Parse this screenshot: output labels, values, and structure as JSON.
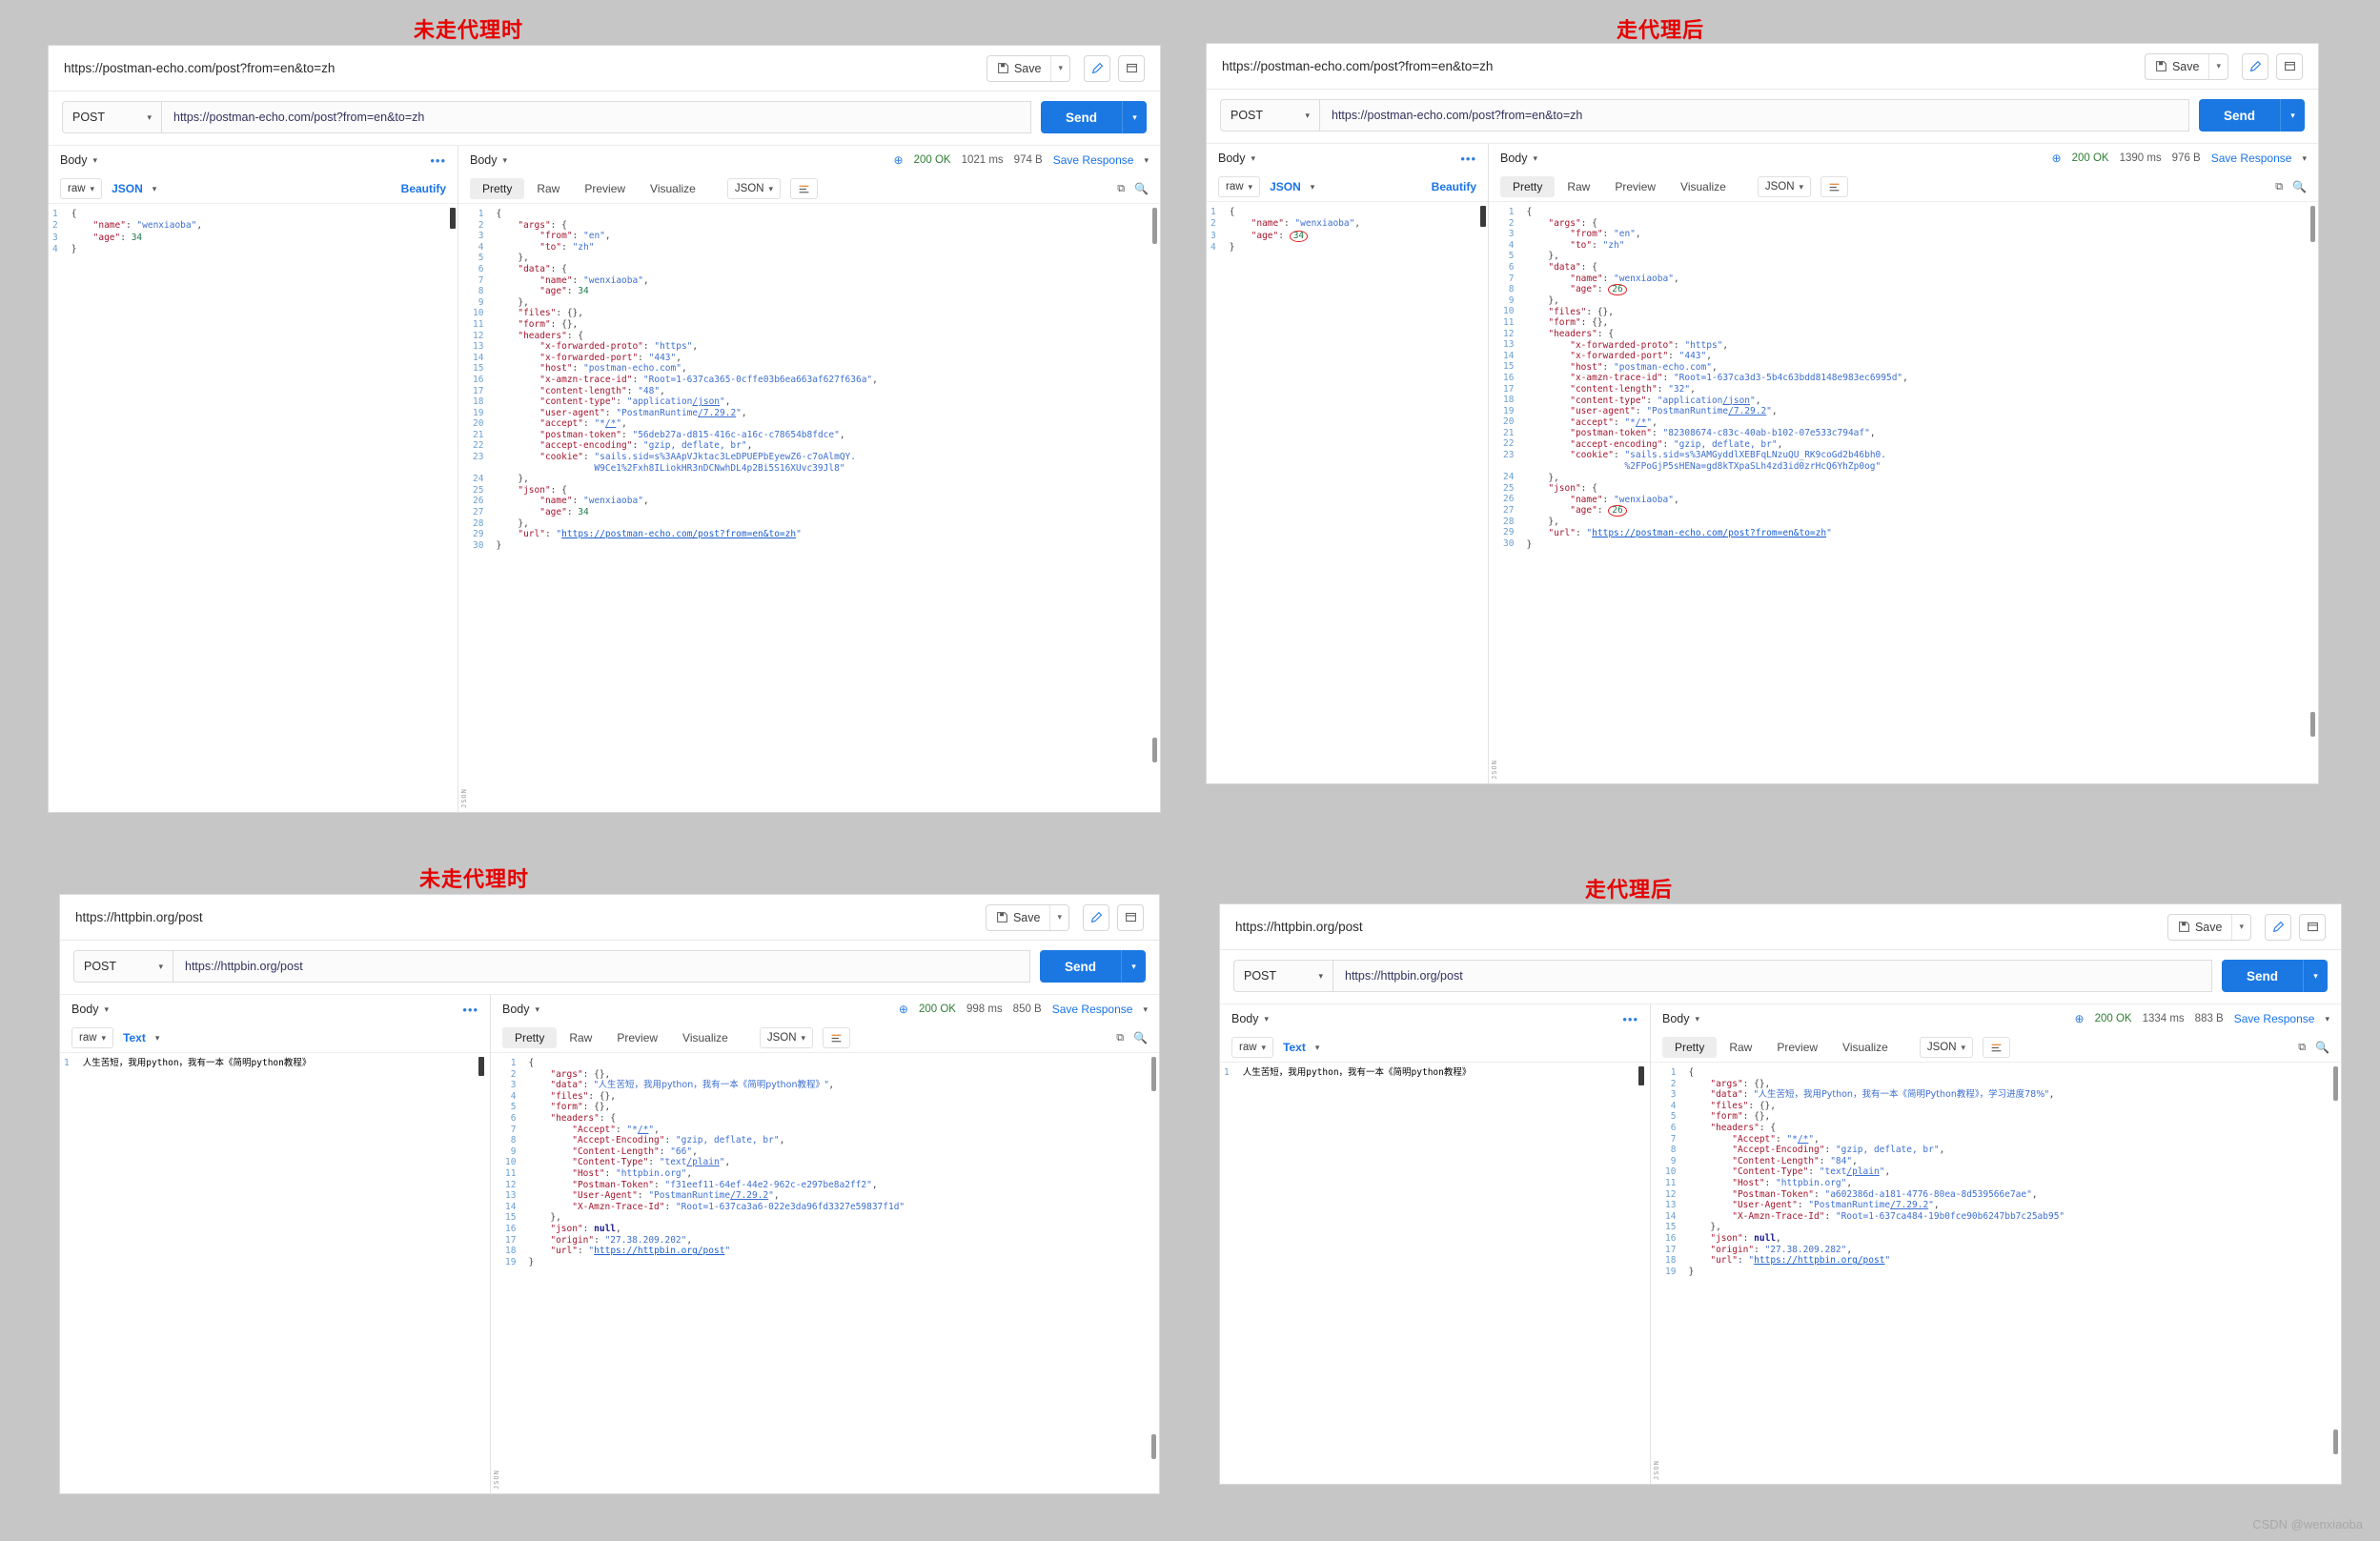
{
  "labels": {
    "top_left": "未走代理时",
    "top_right": "走代理后",
    "bottom_left": "未走代理时",
    "bottom_right": "走代理后"
  },
  "watermark": "CSDN @wenxiaoba",
  "common": {
    "save_label": "Save",
    "send_label": "Send",
    "method": "POST",
    "body_label": "Body",
    "raw_label": "raw",
    "beautify_label": "Beautify",
    "save_response_label": "Save Response",
    "tabs": [
      "Pretty",
      "Raw",
      "Preview",
      "Visualize"
    ],
    "active_tab": "Pretty",
    "status_ok": "200 OK",
    "caret_icon": "chevron-down-icon",
    "save_icon": "save-icon",
    "edit_icon": "pencil-icon",
    "window_icon": "window-icon",
    "more_icon": "ellipsis-icon",
    "globe_icon": "globe-icon",
    "copy_icon": "copy-icon",
    "search_icon": "search-icon",
    "wrap_icon": "wrap-lines-icon"
  },
  "panels": [
    {
      "id": "p1",
      "crumb": "https://postman-echo.com/post?from=en&to=zh",
      "url": "https://postman-echo.com/post?from=en&to=zh",
      "body_format": "JSON",
      "request_lines": [
        "{",
        "    \"name\": \"wenxiaoba\",",
        "    \"age\": 34",
        "}"
      ],
      "status_time": "1021 ms",
      "status_size": "974 B",
      "response_format": "JSON",
      "response_lines": [
        "{",
        "    \"args\": {",
        "        \"from\": \"en\",",
        "        \"to\": \"zh\"",
        "    },",
        "    \"data\": {",
        "        \"name\": \"wenxiaoba\",",
        "        \"age\": 34",
        "    },",
        "    \"files\": {},",
        "    \"form\": {},",
        "    \"headers\": {",
        "        \"x-forwarded-proto\": \"https\",",
        "        \"x-forwarded-port\": \"443\",",
        "        \"host\": \"postman-echo.com\",",
        "        \"x-amzn-trace-id\": \"Root=1-637ca365-0cffe03b6ea663af627f636a\",",
        "        \"content-length\": \"48\",",
        "        \"content-type\": \"application/json\",",
        "        \"user-agent\": \"PostmanRuntime/7.29.2\",",
        "        \"accept\": \"*/*\",",
        "        \"postman-token\": \"56deb27a-d815-416c-a16c-c78654b8fdce\",",
        "        \"accept-encoding\": \"gzip, deflate, br\",",
        "        \"cookie\": \"sails.sid=s%3AApVJktac3LeDPUEPbEyewZ6-c7oAlmQY.",
        "                   W9Ce1%2Fxh8ILiokHR3nDCNwhDL4p2Bi5S16XUvc39Jl8\"",
        "    },",
        "    \"json\": {",
        "        \"name\": \"wenxiaoba\",",
        "        \"age\": 34",
        "    },",
        "    \"url\": \"https://postman-echo.com/post?from=en&to=zh\"",
        "}"
      ]
    },
    {
      "id": "p2",
      "crumb": "https://postman-echo.com/post?from=en&to=zh",
      "url": "https://postman-echo.com/post?from=en&to=zh",
      "body_format": "JSON",
      "request_lines": [
        "{",
        "    \"name\": \"wenxiaoba\",",
        "    \"age\": 34",
        "}"
      ],
      "status_time": "1390 ms",
      "status_size": "976 B",
      "response_format": "JSON",
      "response_lines": [
        "{",
        "    \"args\": {",
        "        \"from\": \"en\",",
        "        \"to\": \"zh\"",
        "    },",
        "    \"data\": {",
        "        \"name\": \"wenxiaoba\",",
        "        \"age\": 26",
        "    },",
        "    \"files\": {},",
        "    \"form\": {},",
        "    \"headers\": {",
        "        \"x-forwarded-proto\": \"https\",",
        "        \"x-forwarded-port\": \"443\",",
        "        \"host\": \"postman-echo.com\",",
        "        \"x-amzn-trace-id\": \"Root=1-637ca3d3-5b4c63bdd8148e983ec6995d\",",
        "        \"content-length\": \"32\",",
        "        \"content-type\": \"application/json\",",
        "        \"user-agent\": \"PostmanRuntime/7.29.2\",",
        "        \"accept\": \"*/*\",",
        "        \"postman-token\": \"82308674-c83c-40ab-b102-07e533c794af\",",
        "        \"accept-encoding\": \"gzip, deflate, br\",",
        "        \"cookie\": \"sails.sid=s%3AMGyddlXEBFqLNzuQU_RK9coGd2b46bh0.",
        "                   %2FPoGjP5sHENa=gd8kTXpaSLh4zd3id0zrHcQ6YhZp0og\"",
        "    },",
        "    \"json\": {",
        "        \"name\": \"wenxiaoba\",",
        "        \"age\": 26",
        "    },",
        "    \"url\": \"https://postman-echo.com/post?from=en&to=zh\"",
        "}"
      ]
    },
    {
      "id": "p3",
      "crumb": "https://httpbin.org/post",
      "url": "https://httpbin.org/post",
      "body_format": "Text",
      "request_lines": [
        "人生苦短，我用python，我有一本《简明python教程》"
      ],
      "status_time": "998 ms",
      "status_size": "850 B",
      "response_format": "JSON",
      "response_lines": [
        "{",
        "    \"args\": {},",
        "    \"data\": \"人生苦短，我用python，我有一本《简明python教程》\",",
        "    \"files\": {},",
        "    \"form\": {},",
        "    \"headers\": {",
        "        \"Accept\": \"*/*\",",
        "        \"Accept-Encoding\": \"gzip, deflate, br\",",
        "        \"Content-Length\": \"66\",",
        "        \"Content-Type\": \"text/plain\",",
        "        \"Host\": \"httpbin.org\",",
        "        \"Postman-Token\": \"f31eef11-64ef-44e2-962c-e297be8a2ff2\",",
        "        \"User-Agent\": \"PostmanRuntime/7.29.2\",",
        "        \"X-Amzn-Trace-Id\": \"Root=1-637ca3a6-022e3da96fd3327e59837f1d\"",
        "    },",
        "    \"json\": null,",
        "    \"origin\": \"27.38.209.202\",",
        "    \"url\": \"https://httpbin.org/post\"",
        "}"
      ]
    },
    {
      "id": "p4",
      "crumb": "https://httpbin.org/post",
      "url": "https://httpbin.org/post",
      "body_format": "Text",
      "request_lines": [
        "人生苦短，我用python，我有一本《简明python教程》"
      ],
      "status_time": "1334 ms",
      "status_size": "883 B",
      "response_format": "JSON",
      "response_lines": [
        "{",
        "    \"args\": {},",
        "    \"data\": \"人生苦短，我用Python，我有一本《简明Python教程》，学习进度78%\",",
        "    \"files\": {},",
        "    \"form\": {},",
        "    \"headers\": {",
        "        \"Accept\": \"*/*\",",
        "        \"Accept-Encoding\": \"gzip, deflate, br\",",
        "        \"Content-Length\": \"84\",",
        "        \"Content-Type\": \"text/plain\",",
        "        \"Host\": \"httpbin.org\",",
        "        \"Postman-Token\": \"a602386d-a181-4776-80ea-8d539566e7ae\",",
        "        \"User-Agent\": \"PostmanRuntime/7.29.2\",",
        "        \"X-Amzn-Trace-Id\": \"Root=1-637ca484-19b0fce90b6247bb7c25ab95\"",
        "    },",
        "    \"json\": null,",
        "    \"origin\": \"27.38.209.282\",",
        "    \"url\": \"https://httpbin.org/post\"",
        "}"
      ]
    }
  ]
}
